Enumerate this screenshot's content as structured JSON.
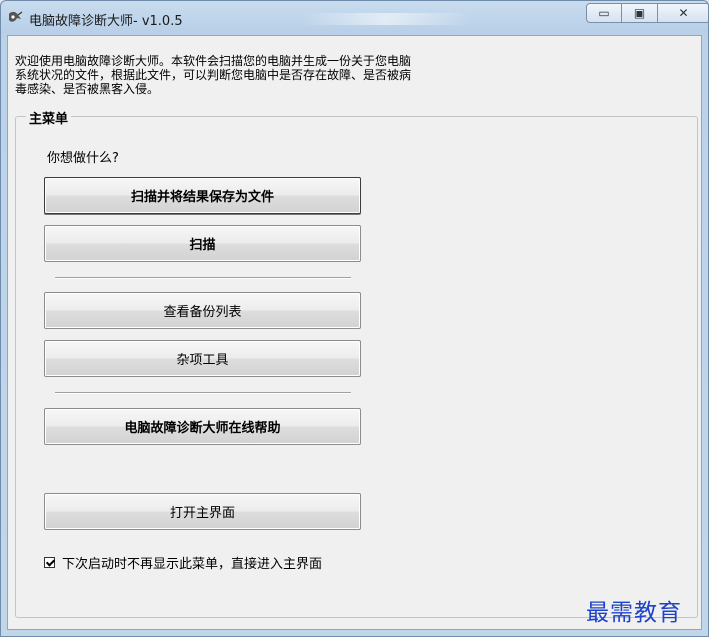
{
  "window": {
    "title": "电脑故障诊断大师- v1.0.5",
    "controls": {
      "minimize": "▭",
      "maximize": "▣",
      "close": "✕"
    }
  },
  "intro": {
    "lines": [
      "欢迎使用电脑故障诊断大师。本软件会扫描您的电脑并生成一份关于您电脑",
      "系统状况的文件，根据此文件，可以判断您电脑中是否存在故障、是否被病",
      "毒感染、是否被黑客入侵。"
    ]
  },
  "main_menu": {
    "title": "主菜单",
    "prompt": "你想做什么?",
    "buttons": {
      "scan_save": "扫描并将结果保存为文件",
      "scan": "扫描",
      "view_backups": "查看备份列表",
      "misc_tools": "杂项工具",
      "online_help": "电脑故障诊断大师在线帮助",
      "open_main": "打开主界面"
    },
    "checkbox": {
      "label": "下次启动时不再显示此菜单，直接进入主界面",
      "checked": true
    }
  },
  "watermark": "最需教育"
}
